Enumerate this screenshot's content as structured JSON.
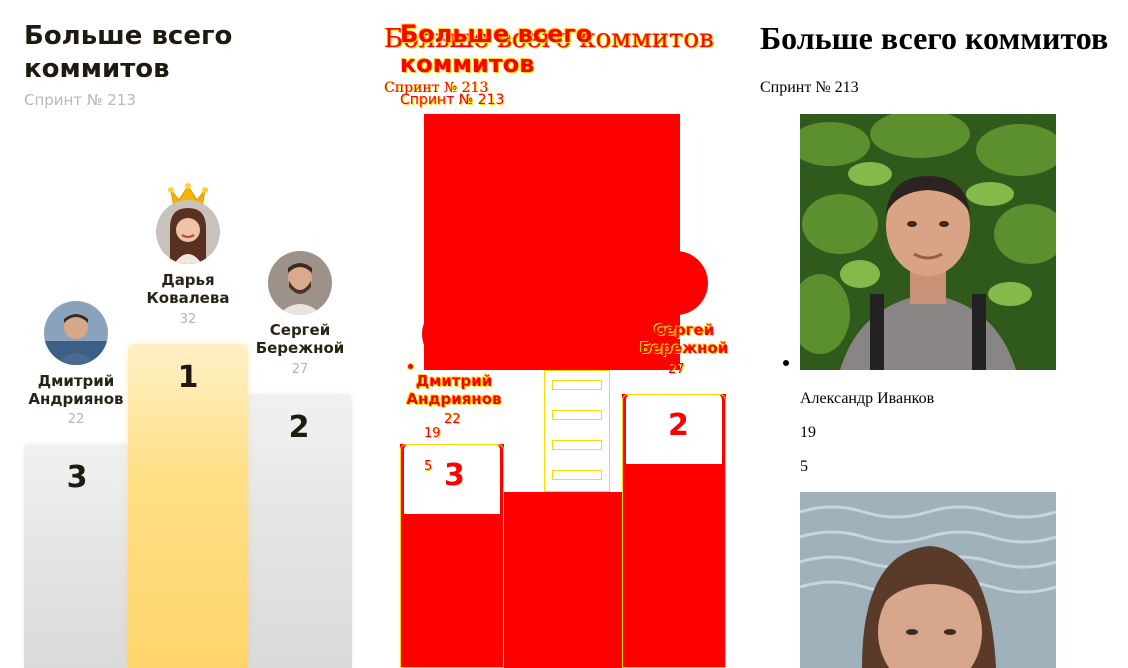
{
  "leaderboard": {
    "title": "Больше всего коммитов",
    "subtitle": "Спринт № 213",
    "podium": [
      {
        "rank": "1",
        "name": "Дарья Ковалева",
        "value": "32",
        "avatar": "avatar-female-icon",
        "crown": "crown-icon"
      },
      {
        "rank": "2",
        "name": "Сергей Бережной",
        "value": "27",
        "avatar": "avatar-male-bearded-icon"
      },
      {
        "rank": "3",
        "name": "Дмитрий Андриянов",
        "value": "22",
        "avatar": "avatar-male-icon"
      }
    ]
  },
  "broken_view": {
    "title": "Больше всего коммитов",
    "subtitle": "Спринт № 213",
    "names": {
      "first_name": "Дмитрий",
      "first_surname": "Андриянов",
      "second_name": "Сергей",
      "second_surname": "Бережной"
    },
    "values": {
      "a": "22",
      "b": "19",
      "c": "5",
      "d": "27"
    },
    "ranks": {
      "two": "2",
      "three": "3"
    }
  },
  "plain_view": {
    "title": "Больше всего коммитов",
    "subtitle": "Спринт № 213",
    "first_entry": {
      "name": "Александр Иванков",
      "value": "19",
      "extra": "5",
      "photo": "person-photo-icon"
    },
    "second_photo": "person-photo-icon"
  },
  "colors": {
    "title": "#1f1a10",
    "subtitle": "#b8b8b8",
    "gold_bar": "#ffd56b",
    "gray_bar": "#e3e3e3",
    "glitch_red": "#ff0000",
    "glitch_yellow": "#ffd800"
  }
}
